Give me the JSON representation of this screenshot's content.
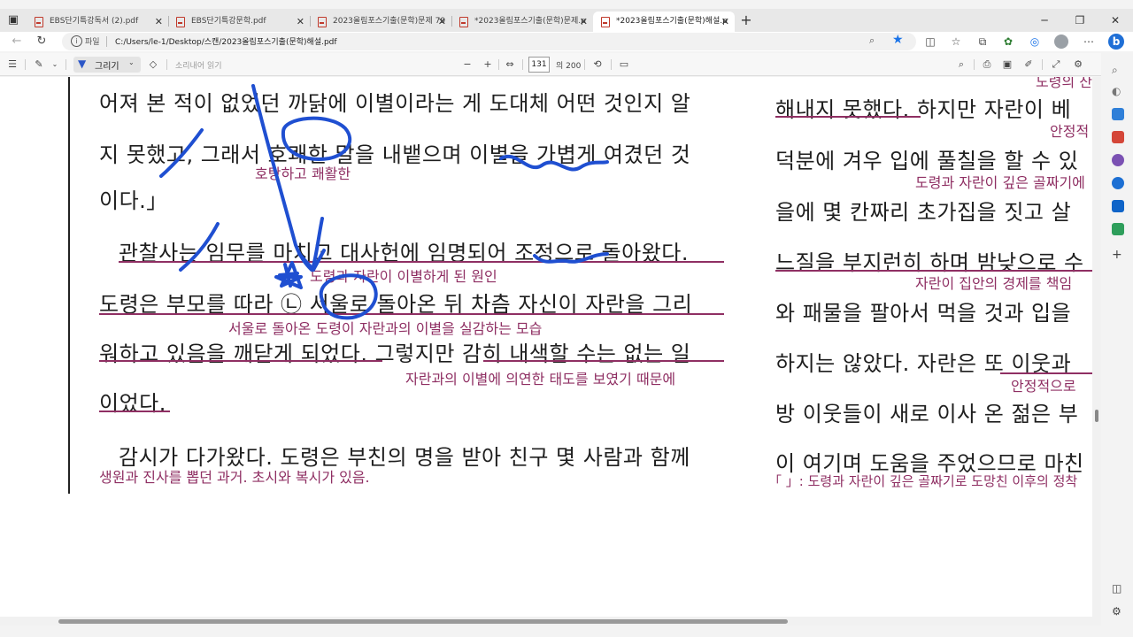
{
  "tabs": [
    {
      "title": "EBS단기특강독서 (2).pdf",
      "active": false
    },
    {
      "title": "EBS단기특강문학.pdf",
      "active": false
    },
    {
      "title": "2023올림포스기출(문학)문제 79",
      "active": false
    },
    {
      "title": "*2023올림포스기출(문학)문제.p",
      "active": false
    },
    {
      "title": "*2023올림포스기출(문학)해설.p",
      "active": true
    }
  ],
  "address": {
    "label": "파일",
    "url": "C:/Users/le-1/Desktop/스캔/2023올림포스기출(문학)해설.pdf"
  },
  "toolbar": {
    "draw_label": "그리기",
    "read_aloud": "소리내어 읽기",
    "page_current": "131",
    "page_total": "의 200"
  },
  "document": {
    "lines": [
      "어져 본 적이 없었던 까닭에 이별이라는 게 도대체 어떤 것인지 알",
      "지 못했고, 그래서 호쾌한 말을 내뱉으며 이별을 가볍게 여겼던 것",
      "이다.」",
      "관찰사는 임무를 마치고 대사헌에 임명되어 조정으로 돌아왔다.",
      "도령은 부모를 따라 ㉡ 서울로 돌아온 뒤 차츰 자신이 자란을 그리",
      "워하고 있음을 깨닫게 되었다. 그렇지만 감히 내색할 수는 없는 일",
      "이었다.",
      "감시가 다가왔다. 도령은 부친의 명을 받아 친구 몇 사람과 함께"
    ],
    "notes": [
      "호탕하고 쾌활한",
      "도령과 자란이 이별하게 된 원인",
      "서울로 돌아온 도령이 자란과의 이별을 실감하는 모습",
      "자란과의 이별에 의연한 태도를 보였기 때문에",
      "생원과 진사를 뽑던 과거. 초시와 복시가 있음."
    ],
    "right_lines": [
      "해내지 못했다. 하지만 자란이 베",
      "덕분에 겨우 입에 풀칠을 할 수 있",
      "을에 몇 칸짜리 초가집을 짓고 살",
      "느질을 부지런히 하며 밤낮으로 수",
      "와 패물을 팔아서 먹을 것과 입을",
      "하지는 않았다. 자란은 또 이웃과",
      "방 이웃들이 새로 이사 온 젊은 부",
      "이 여기며 도움을 주었으므로 마친"
    ],
    "right_notes": [
      "도령의 산",
      "안정적",
      "도령과 자란이 깊은 골짜기에",
      "자란이 집안의 경제를 책임",
      "안정적으로",
      "「 」: 도령과 자란이 깊은 골짜기로 도망친 이후의 정착"
    ]
  },
  "colors": {
    "ink": "#1f4fd1",
    "annotation": "#8f2f63",
    "accent": "#1a73e8"
  }
}
